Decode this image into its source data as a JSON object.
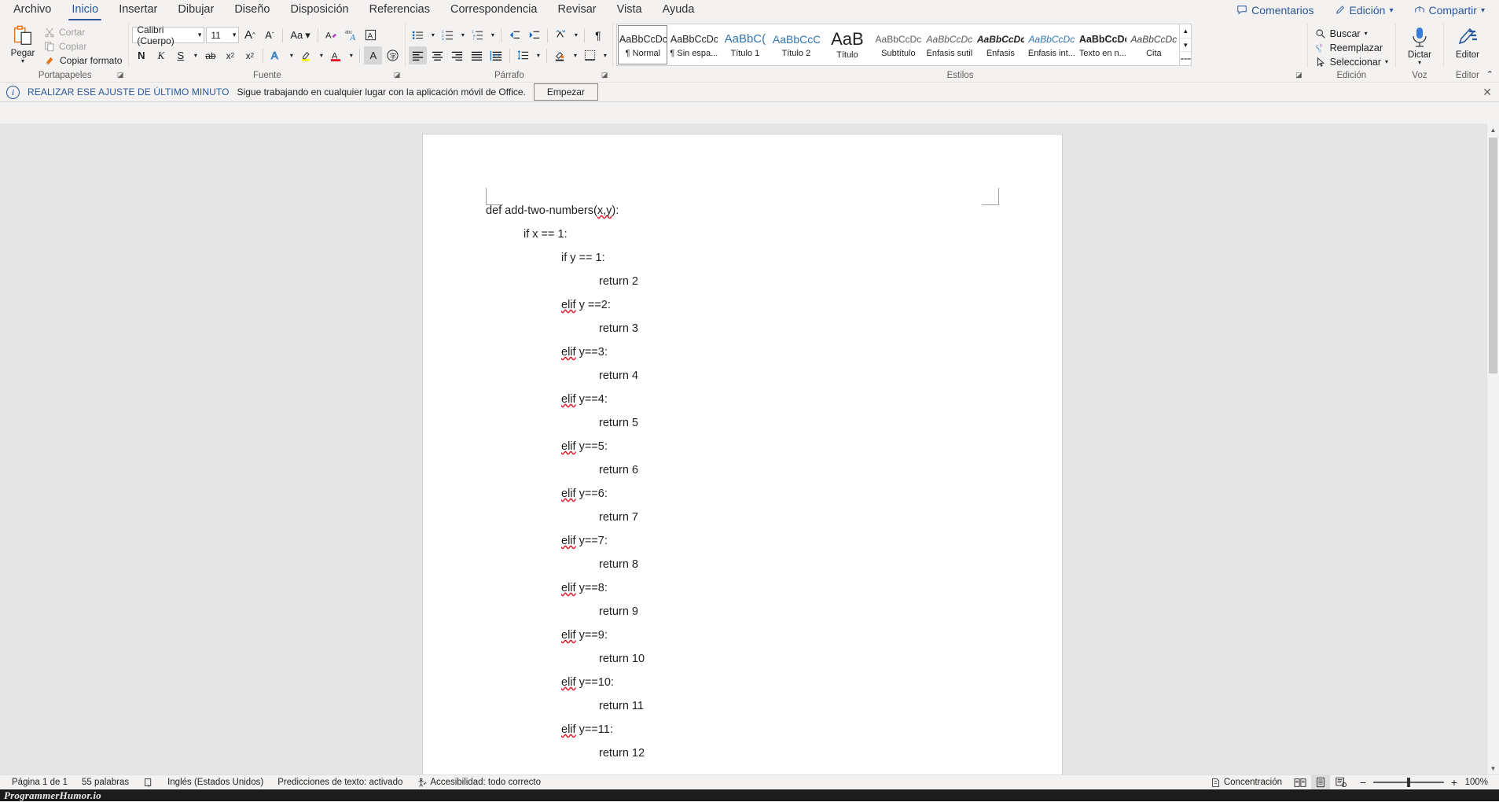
{
  "tabs": [
    {
      "label": "Archivo",
      "active": false
    },
    {
      "label": "Inicio",
      "active": true
    },
    {
      "label": "Insertar",
      "active": false
    },
    {
      "label": "Dibujar",
      "active": false
    },
    {
      "label": "Diseño",
      "active": false
    },
    {
      "label": "Disposición",
      "active": false
    },
    {
      "label": "Referencias",
      "active": false
    },
    {
      "label": "Correspondencia",
      "active": false
    },
    {
      "label": "Revisar",
      "active": false
    },
    {
      "label": "Vista",
      "active": false
    },
    {
      "label": "Ayuda",
      "active": false
    }
  ],
  "titlebar_actions": [
    {
      "label": "Comentarios",
      "icon": "comment-icon",
      "caret": false
    },
    {
      "label": "Edición",
      "icon": "pencil-icon",
      "caret": true
    },
    {
      "label": "Compartir",
      "icon": "share-icon",
      "caret": true
    }
  ],
  "ribbon": {
    "clipboard": {
      "group_label": "Portapapeles",
      "paste_label": "Pegar",
      "items": [
        {
          "label": "Cortar",
          "icon": "scissors-icon",
          "enabled": false
        },
        {
          "label": "Copiar",
          "icon": "copy-icon",
          "enabled": false
        },
        {
          "label": "Copiar formato",
          "icon": "format-painter-icon",
          "enabled": true
        }
      ]
    },
    "font": {
      "group_label": "Fuente",
      "font_name": "Calibri (Cuerpo)",
      "font_size": "11",
      "row1": [
        {
          "name": "grow-font-icon",
          "glyph": "A"
        },
        {
          "name": "shrink-font-icon",
          "glyph": "A"
        },
        {
          "name": "change-case-icon",
          "glyph": "Aa"
        },
        {
          "name": "clear-formatting-icon",
          "glyph": "A"
        },
        {
          "name": "phonetic-guide-icon",
          "glyph": "A"
        },
        {
          "name": "character-border-icon",
          "glyph": "A"
        }
      ],
      "row2": [
        {
          "name": "bold-icon",
          "glyph": "N"
        },
        {
          "name": "italic-icon",
          "glyph": "K"
        },
        {
          "name": "underline-icon",
          "glyph": "S"
        },
        {
          "name": "strikethrough-icon",
          "glyph": "ab"
        },
        {
          "name": "subscript-icon",
          "glyph": "x₂"
        },
        {
          "name": "superscript-icon",
          "glyph": "x²"
        },
        {
          "name": "text-effects-icon",
          "glyph": "A"
        },
        {
          "name": "text-highlight-color-icon",
          "glyph": "✎"
        },
        {
          "name": "font-color-icon",
          "glyph": "A"
        },
        {
          "name": "character-shading-icon",
          "glyph": "A"
        },
        {
          "name": "enclose-characters-icon",
          "glyph": "字"
        }
      ]
    },
    "paragraph": {
      "group_label": "Párrafo",
      "row1": [
        {
          "name": "bullets-icon"
        },
        {
          "name": "numbering-icon"
        },
        {
          "name": "multilevel-list-icon"
        },
        {
          "name": "decrease-indent-icon"
        },
        {
          "name": "increase-indent-icon"
        },
        {
          "name": "sort-icon"
        },
        {
          "name": "show-formatting-marks-icon"
        }
      ],
      "row2": [
        {
          "name": "align-left-icon"
        },
        {
          "name": "align-center-icon"
        },
        {
          "name": "align-right-icon"
        },
        {
          "name": "justify-icon"
        },
        {
          "name": "distributed-icon"
        },
        {
          "name": "line-spacing-icon"
        },
        {
          "name": "shading-icon"
        },
        {
          "name": "borders-icon"
        }
      ]
    },
    "styles": {
      "group_label": "Estilos",
      "items": [
        {
          "preview": "AaBbCcDc",
          "name": "¶ Normal",
          "selected": true,
          "style": "normal"
        },
        {
          "preview": "AaBbCcDc",
          "name": "¶ Sin espa...",
          "selected": false,
          "style": "normal"
        },
        {
          "preview": "AaBbC(",
          "name": "Título 1",
          "selected": false,
          "style": "h1"
        },
        {
          "preview": "AaBbCcC",
          "name": "Título 2",
          "selected": false,
          "style": "h2"
        },
        {
          "preview": "AaB",
          "name": "Título",
          "selected": false,
          "style": "title"
        },
        {
          "preview": "AaBbCcDc",
          "name": "Subtítulo",
          "selected": false,
          "style": "subtitle"
        },
        {
          "preview": "AaBbCcDc",
          "name": "Énfasis sutil",
          "selected": false,
          "style": "subtle-em"
        },
        {
          "preview": "AaBbCcDc",
          "name": "Énfasis",
          "selected": false,
          "style": "em"
        },
        {
          "preview": "AaBbCcDc",
          "name": "Énfasis int...",
          "selected": false,
          "style": "intense-em"
        },
        {
          "preview": "AaBbCcDc",
          "name": "Texto en n...",
          "selected": false,
          "style": "strong"
        },
        {
          "preview": "AaBbCcDc",
          "name": "Cita",
          "selected": false,
          "style": "quote"
        }
      ]
    },
    "editing": {
      "group_label": "Edición",
      "items": [
        {
          "label": "Buscar",
          "icon": "search-icon",
          "caret": true
        },
        {
          "label": "Reemplazar",
          "icon": "replace-icon",
          "caret": false
        },
        {
          "label": "Seleccionar",
          "icon": "select-icon",
          "caret": true
        }
      ]
    },
    "voice": {
      "group_label": "Voz",
      "button": "Dictar",
      "icon": "microphone-icon"
    },
    "editor": {
      "group_label": "Editor",
      "button": "Editor",
      "icon": "editor-pen-icon"
    }
  },
  "infobar": {
    "title": "REALIZAR ESE AJUSTE DE ÚLTIMO MINUTO",
    "message": "Sigue trabajando en cualquier lugar con la aplicación móvil de Office.",
    "button": "Empezar",
    "close": "✕"
  },
  "document": {
    "lines": [
      {
        "indent": 0,
        "text": "def add-two-numbers(x,y):",
        "misspelled": "x,y"
      },
      {
        "indent": 1,
        "text": "if x == 1:",
        "misspelled": ""
      },
      {
        "indent": 2,
        "text": "if y == 1:",
        "misspelled": ""
      },
      {
        "indent": 3,
        "text": "return 2",
        "misspelled": ""
      },
      {
        "indent": 2,
        "text": "elif y ==2:",
        "misspelled": "elif"
      },
      {
        "indent": 3,
        "text": "return 3",
        "misspelled": ""
      },
      {
        "indent": 2,
        "text": "elif y==3:",
        "misspelled": "elif"
      },
      {
        "indent": 3,
        "text": "return 4",
        "misspelled": ""
      },
      {
        "indent": 2,
        "text": "elif y==4:",
        "misspelled": "elif"
      },
      {
        "indent": 3,
        "text": "return 5",
        "misspelled": ""
      },
      {
        "indent": 2,
        "text": "elif y==5:",
        "misspelled": "elif"
      },
      {
        "indent": 3,
        "text": "return 6",
        "misspelled": ""
      },
      {
        "indent": 2,
        "text": "elif y==6:",
        "misspelled": "elif"
      },
      {
        "indent": 3,
        "text": "return 7",
        "misspelled": ""
      },
      {
        "indent": 2,
        "text": "elif y==7:",
        "misspelled": "elif"
      },
      {
        "indent": 3,
        "text": "return 8",
        "misspelled": ""
      },
      {
        "indent": 2,
        "text": "elif y==8:",
        "misspelled": "elif"
      },
      {
        "indent": 3,
        "text": "return 9",
        "misspelled": ""
      },
      {
        "indent": 2,
        "text": "elif y==9:",
        "misspelled": "elif"
      },
      {
        "indent": 3,
        "text": "return 10",
        "misspelled": ""
      },
      {
        "indent": 2,
        "text": "elif y==10:",
        "misspelled": "elif"
      },
      {
        "indent": 3,
        "text": "return 11",
        "misspelled": ""
      },
      {
        "indent": 2,
        "text": "elif y==11:",
        "misspelled": "elif"
      },
      {
        "indent": 3,
        "text": "return 12",
        "misspelled": ""
      }
    ]
  },
  "status": {
    "page": "Página 1 de 1",
    "words": "55 palabras",
    "proofing_icon": "proofing-icon",
    "language": "Inglés (Estados Unidos)",
    "text_predictions": "Predicciones de texto: activado",
    "accessibility": "Accesibilidad: todo correcto",
    "focus": "Concentración",
    "views": [
      {
        "name": "read-mode-icon",
        "selected": false
      },
      {
        "name": "print-layout-icon",
        "selected": true
      },
      {
        "name": "web-layout-icon",
        "selected": false
      }
    ],
    "zoom_out": "−",
    "zoom_in": "+",
    "zoom_value": "100%"
  },
  "watermark": "ProgrammerHumor.io",
  "colors": {
    "accent": "#2b579a",
    "ribbon_bg": "#f3f2f1",
    "doc_bg": "#e6e6e6",
    "highlight_yellow": "#ffff00",
    "font_color_red": "#e81123",
    "orange": "#e8761b"
  }
}
